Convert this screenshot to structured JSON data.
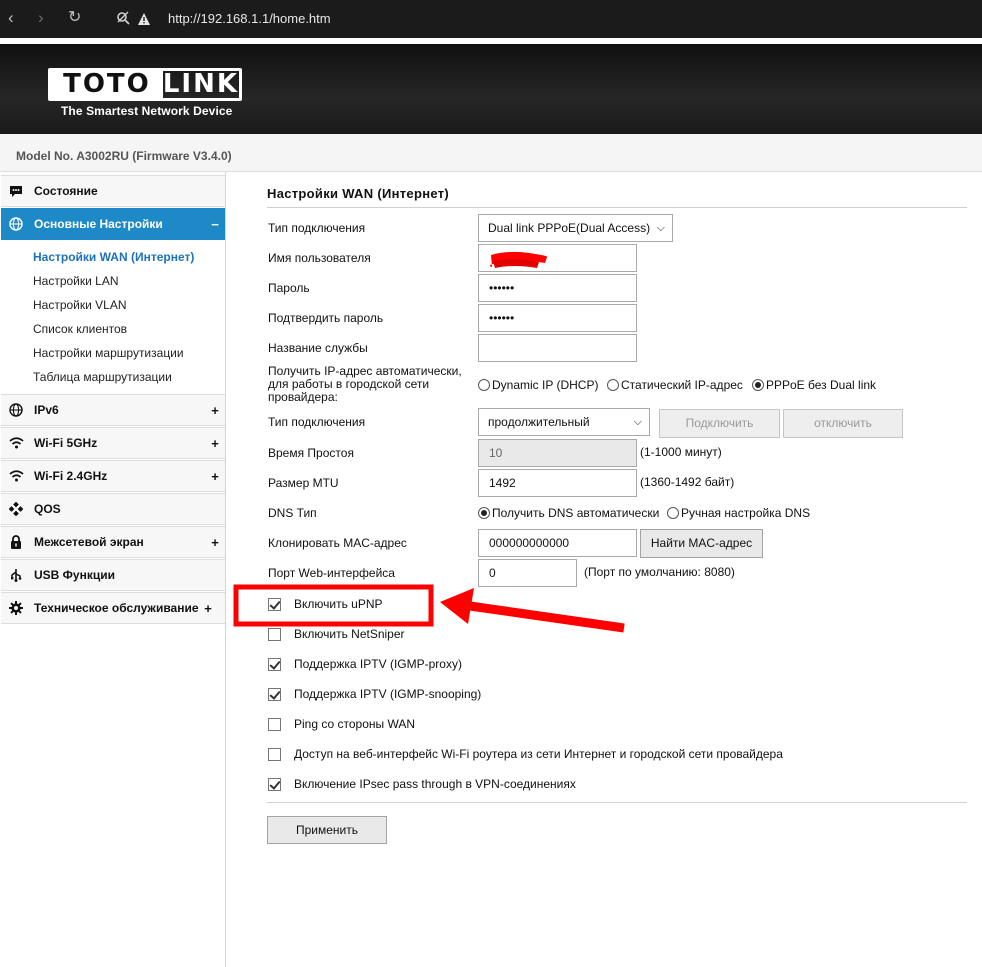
{
  "browser": {
    "url": "http://192.168.1.1/home.htm",
    "icons": [
      "back-icon",
      "forward-icon",
      "reload-icon",
      "site-info-icon",
      "warning-icon"
    ]
  },
  "header": {
    "logo_left": "TOTO",
    "logo_right": "LINK",
    "tagline": "The Smartest Network Device"
  },
  "model": "Model No. A3002RU (Firmware V3.4.0)",
  "sidebar": {
    "items": [
      {
        "label": "Состояние",
        "icon": "chat-icon",
        "plus": ""
      },
      {
        "label": "Основные Настройки",
        "icon": "globe-icon",
        "plus": "−"
      },
      {
        "label": "IPv6",
        "icon": "globe-icon",
        "plus": "+"
      },
      {
        "label": "Wi-Fi 5GHz",
        "icon": "wifi-icon",
        "plus": "+"
      },
      {
        "label": "Wi-Fi 2.4GHz",
        "icon": "wifi-icon",
        "plus": "+"
      },
      {
        "label": "QOS",
        "icon": "qos-icon",
        "plus": ""
      },
      {
        "label": "Межсетевой экран",
        "icon": "lock-icon",
        "plus": "+"
      },
      {
        "label": "USB Функции",
        "icon": "usb-icon",
        "plus": ""
      },
      {
        "label": "Техническое обслуживание",
        "icon": "gear-icon",
        "plus": "+"
      }
    ],
    "submenu": [
      "Настройки WAN (Интернет)",
      "Настройки LAN",
      "Настройки VLAN",
      "Список клиентов",
      "Настройки маршрутизации",
      "Таблица маршрутизации"
    ]
  },
  "form": {
    "title": "Настройки WAN (Интернет)",
    "conn_type_label": "Тип подключения",
    "conn_type_value": "Dual link PPPoE(Dual Access)",
    "username_label": "Имя пользователя",
    "username_value": "",
    "password_label": "Пароль",
    "password_value": "••••••",
    "confirm_label": "Подтвердить пароль",
    "confirm_value": "••••••",
    "service_label": "Название службы",
    "service_value": "",
    "ipmode_label_1": "Получить IP-адрес автоматически,",
    "ipmode_label_2": "для работы в городской сети",
    "ipmode_label_3": "провайдера:",
    "ipmode_options": [
      "Dynamic IP (DHCP)",
      "Статический IP-адрес",
      "PPPoE без Dual link"
    ],
    "ipmode_selected": 2,
    "conn_mode_label": "Тип подключения",
    "conn_mode_value": "продолжительный",
    "connect_button": "Подключить",
    "disconnect_button": "отключить",
    "idle_label": "Время Простоя",
    "idle_value": "10",
    "idle_hint": "(1-1000 минут)",
    "mtu_label": "Размер MTU",
    "mtu_value": "1492",
    "mtu_hint": "(1360-1492 байт)",
    "dns_label": "DNS Тип",
    "dns_options": [
      "Получить DNS автоматически",
      "Ручная настройка DNS"
    ],
    "dns_selected": 0,
    "mac_label": "Клонировать MAC-адрес",
    "mac_value": "000000000000",
    "mac_button": "Найти MAC-адрес",
    "webport_label": "Порт Web-интерфейса",
    "webport_value": "0",
    "webport_hint": "(Порт по умолчанию: 8080)",
    "checkboxes": [
      {
        "label": "Включить uPNP",
        "checked": true
      },
      {
        "label": "Включить NetSniper",
        "checked": false
      },
      {
        "label": "Поддержка IPTV (IGMP-proxy)",
        "checked": true
      },
      {
        "label": "Поддержка IPTV (IGMP-snooping)",
        "checked": true
      },
      {
        "label": "Ping со стороны WAN",
        "checked": false
      },
      {
        "label": "Доступ на веб-интерфейс Wi-Fi роутера из сети Интернет и городской сети провайдера",
        "checked": false
      },
      {
        "label": "Включение IPsec pass through в VPN-соединениях",
        "checked": true
      }
    ],
    "apply_button": "Применить"
  },
  "colors": {
    "accent": "#1d8ac7",
    "annotation": "#ff0000"
  }
}
